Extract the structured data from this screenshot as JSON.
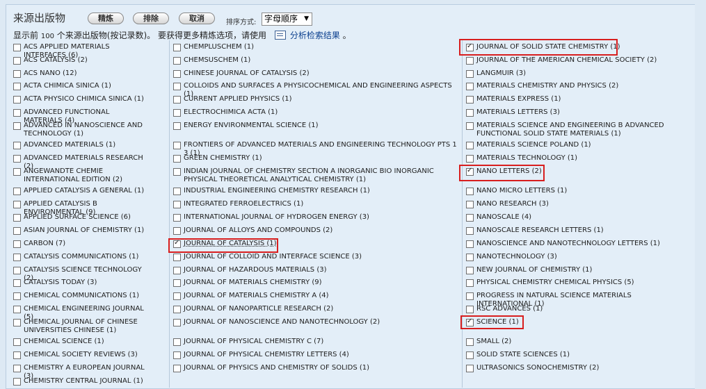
{
  "header": {
    "title": "来源出版物",
    "refine_label": "精炼",
    "exclude_label": "排除",
    "cancel_label": "取消",
    "sort_label": "排序方式:",
    "sort_value": "字母顺序"
  },
  "info": {
    "prefix": "显示前",
    "count": "100",
    "middle": "个来源出版物",
    "paren": "(按记录数)。",
    "more": "要获得更多精炼选项，请使用",
    "link": "分析检索结果",
    "suffix": "。"
  },
  "columns": [
    [
      {
        "label": "ACS APPLIED MATERIALS INTERFACES (6)",
        "checked": false
      },
      {
        "label": "ACS CATALYSIS (2)",
        "checked": false
      },
      {
        "label": "ACS NANO (12)",
        "checked": false
      },
      {
        "label": "ACTA CHIMICA SINICA (1)",
        "checked": false
      },
      {
        "label": "ACTA PHYSICO CHIMICA SINICA (1)",
        "checked": false
      },
      {
        "label": "ADVANCED FUNCTIONAL MATERIALS (4)",
        "checked": false
      },
      {
        "label": "ADVANCED IN NANOSCIENCE AND TECHNOLOGY (1)",
        "checked": false
      },
      {
        "label": "ADVANCED MATERIALS (1)",
        "checked": false
      },
      {
        "label": "ADVANCED MATERIALS RESEARCH (2)",
        "checked": false
      },
      {
        "label": "ANGEWANDTE CHEMIE INTERNATIONAL EDITION (2)",
        "checked": false
      },
      {
        "label": "APPLIED CATALYSIS A GENERAL (1)",
        "checked": false
      },
      {
        "label": "APPLIED CATALYSIS B ENVIRONMENTAL (9)",
        "checked": false
      },
      {
        "label": "APPLIED SURFACE SCIENCE (6)",
        "checked": false
      },
      {
        "label": "ASIAN JOURNAL OF CHEMISTRY (1)",
        "checked": false
      },
      {
        "label": "CARBON (7)",
        "checked": false
      },
      {
        "label": "CATALYSIS COMMUNICATIONS (1)",
        "checked": false
      },
      {
        "label": "CATALYSIS SCIENCE TECHNOLOGY (2)",
        "checked": false
      },
      {
        "label": "CATALYSIS TODAY (3)",
        "checked": false
      },
      {
        "label": "CHEMICAL COMMUNICATIONS (1)",
        "checked": false
      },
      {
        "label": "CHEMICAL ENGINEERING JOURNAL (5)",
        "checked": false
      },
      {
        "label": "CHEMICAL JOURNAL OF CHINESE UNIVERSITIES CHINESE (1)",
        "checked": false
      },
      {
        "label": "CHEMICAL SCIENCE (1)",
        "checked": false
      },
      {
        "label": "CHEMICAL SOCIETY REVIEWS (3)",
        "checked": false
      },
      {
        "label": "CHEMISTRY A EUROPEAN JOURNAL (3)",
        "checked": false
      },
      {
        "label": "CHEMISTRY CENTRAL JOURNAL (1)",
        "checked": false
      }
    ],
    [
      {
        "label": "CHEMPLUSCHEM (1)",
        "checked": false
      },
      {
        "label": "CHEMSUSCHEM (1)",
        "checked": false
      },
      {
        "label": "CHINESE JOURNAL OF CATALYSIS (2)",
        "checked": false
      },
      {
        "label": "COLLOIDS AND SURFACES A PHYSICOCHEMICAL AND ENGINEERING ASPECTS (1)",
        "checked": false
      },
      {
        "label": "CURRENT APPLIED PHYSICS (1)",
        "checked": false
      },
      {
        "label": "ELECTROCHIMICA ACTA (1)",
        "checked": false
      },
      {
        "label": "ENERGY ENVIRONMENTAL SCIENCE (1)",
        "checked": false
      },
      {
        "label": "FRONTIERS OF ADVANCED MATERIALS AND ENGINEERING TECHNOLOGY PTS 1 3 (1)",
        "checked": false
      },
      {
        "label": "GREEN CHEMISTRY (1)",
        "checked": false
      },
      {
        "label": "INDIAN JOURNAL OF CHEMISTRY SECTION A INORGANIC BIO INORGANIC PHYSICAL THEORETICAL ANALYTICAL CHEMISTRY (1)",
        "checked": false
      },
      {
        "label": "INDUSTRIAL ENGINEERING CHEMISTRY RESEARCH (1)",
        "checked": false
      },
      {
        "label": "INTEGRATED FERROELECTRICS (1)",
        "checked": false
      },
      {
        "label": "INTERNATIONAL JOURNAL OF HYDROGEN ENERGY (3)",
        "checked": false
      },
      {
        "label": "JOURNAL OF ALLOYS AND COMPOUNDS (2)",
        "checked": false
      },
      {
        "label": "JOURNAL OF CATALYSIS (1)",
        "checked": true
      },
      {
        "label": "JOURNAL OF COLLOID AND INTERFACE SCIENCE (3)",
        "checked": false
      },
      {
        "label": "JOURNAL OF HAZARDOUS MATERIALS (3)",
        "checked": false
      },
      {
        "label": "JOURNAL OF MATERIALS CHEMISTRY (9)",
        "checked": false
      },
      {
        "label": "JOURNAL OF MATERIALS CHEMISTRY A (4)",
        "checked": false
      },
      {
        "label": "JOURNAL OF NANOPARTICLE RESEARCH (2)",
        "checked": false
      },
      {
        "label": "JOURNAL OF NANOSCIENCE AND NANOTECHNOLOGY (2)",
        "checked": false
      },
      {
        "label": "JOURNAL OF PHYSICAL CHEMISTRY C (7)",
        "checked": false
      },
      {
        "label": "JOURNAL OF PHYSICAL CHEMISTRY LETTERS (4)",
        "checked": false
      },
      {
        "label": "JOURNAL OF PHYSICS AND CHEMISTRY OF SOLIDS (1)",
        "checked": false
      }
    ],
    [
      {
        "label": "JOURNAL OF SOLID STATE CHEMISTRY (1)",
        "checked": true
      },
      {
        "label": "JOURNAL OF THE AMERICAN CHEMICAL SOCIETY (2)",
        "checked": false
      },
      {
        "label": "LANGMUIR (3)",
        "checked": false
      },
      {
        "label": "MATERIALS CHEMISTRY AND PHYSICS (2)",
        "checked": false
      },
      {
        "label": "MATERIALS EXPRESS (1)",
        "checked": false
      },
      {
        "label": "MATERIALS LETTERS (3)",
        "checked": false
      },
      {
        "label": "MATERIALS SCIENCE AND ENGINEERING B ADVANCED FUNCTIONAL SOLID STATE MATERIALS (1)",
        "checked": false
      },
      {
        "label": "MATERIALS SCIENCE POLAND (1)",
        "checked": false
      },
      {
        "label": "MATERIALS TECHNOLOGY (1)",
        "checked": false
      },
      {
        "label": "NANO LETTERS (2)",
        "checked": true
      },
      {
        "label": "NANO MICRO LETTERS (1)",
        "checked": false
      },
      {
        "label": "NANO RESEARCH (3)",
        "checked": false
      },
      {
        "label": "NANOSCALE (4)",
        "checked": false
      },
      {
        "label": "NANOSCALE RESEARCH LETTERS (1)",
        "checked": false
      },
      {
        "label": "NANOSCIENCE AND NANOTECHNOLOGY LETTERS (1)",
        "checked": false
      },
      {
        "label": "NANOTECHNOLOGY (3)",
        "checked": false
      },
      {
        "label": "NEW JOURNAL OF CHEMISTRY (1)",
        "checked": false
      },
      {
        "label": "PHYSICAL CHEMISTRY CHEMICAL PHYSICS (5)",
        "checked": false
      },
      {
        "label": "PROGRESS IN NATURAL SCIENCE MATERIALS INTERNATIONAL (1)",
        "checked": false
      },
      {
        "label": "RSC ADVANCES (1)",
        "checked": false
      },
      {
        "label": "SCIENCE (1)",
        "checked": true
      },
      {
        "label": "SMALL (2)",
        "checked": false
      },
      {
        "label": "SOLID STATE SCIENCES (1)",
        "checked": false
      },
      {
        "label": "ULTRASONICS SONOCHEMISTRY (2)",
        "checked": false
      }
    ]
  ],
  "colors": {
    "highlight": "#d81e1e",
    "link": "#0b3f8e",
    "panel": "#e3eef8"
  }
}
